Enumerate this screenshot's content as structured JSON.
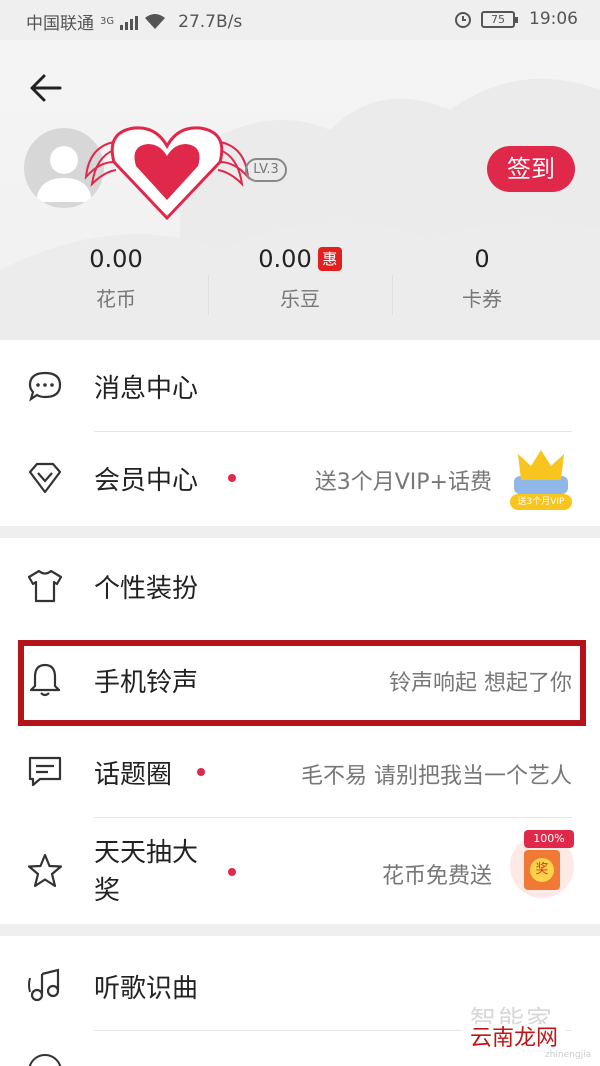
{
  "status_bar": {
    "carrier": "中国联通",
    "network": "3G",
    "speed": "27.7B/s",
    "battery": "75",
    "time": "19:06"
  },
  "header": {
    "level": "LV.3",
    "sign_in_label": "签到",
    "stats": [
      {
        "value": "0.00",
        "label": "花币"
      },
      {
        "value": "0.00",
        "label": "乐豆",
        "badge": "惠"
      },
      {
        "value": "0",
        "label": "卡券"
      }
    ]
  },
  "menu": {
    "section1": [
      {
        "label": "消息中心",
        "icon": "chat-bubble-icon"
      },
      {
        "label": "会员中心",
        "icon": "diamond-icon",
        "sub": "送3个月VIP+话费",
        "thumb_text": "送3个月VIP"
      }
    ],
    "section2": [
      {
        "label": "个性装扮",
        "icon": "tshirt-icon"
      },
      {
        "label": "手机铃声",
        "icon": "bell-icon",
        "sub": "铃声响起 想起了你"
      },
      {
        "label": "话题圈",
        "icon": "message-square-icon",
        "sub": "毛不易 请别把我当一个艺人"
      },
      {
        "label_line1": "天天抽大",
        "label_line2": "奖",
        "icon": "star-icon",
        "sub": "花币免费送",
        "thumb_text": "100%",
        "thumb_char": "奖"
      }
    ],
    "section3": [
      {
        "label": "听歌识曲",
        "icon": "music-note-icon"
      }
    ]
  },
  "watermark": {
    "line1": "智能家",
    "line2": "云南龙网",
    "line3": "zhinengjia"
  },
  "colors": {
    "accent": "#e0284a",
    "highlight_box": "#b2141a",
    "page_bg": "#efefef"
  }
}
